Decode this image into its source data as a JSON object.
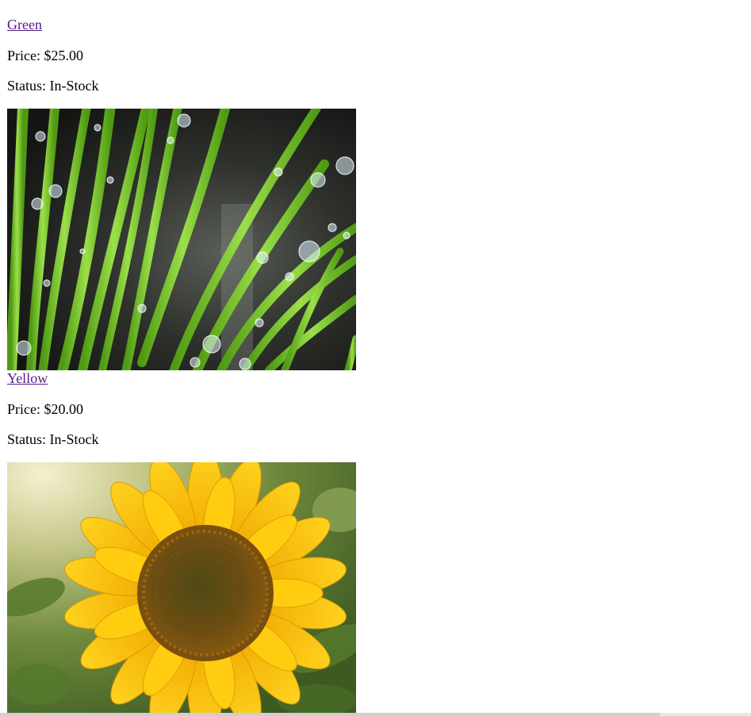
{
  "products": [
    {
      "name": "Green",
      "price_text": "Price: $25.00",
      "status_text": "Status: In-Stock",
      "image_icon": "green-stems-with-water-drops"
    },
    {
      "name": "Yellow",
      "price_text": "Price: $20.00",
      "status_text": "Status: In-Stock",
      "image_icon": "sunflower"
    }
  ],
  "colors": {
    "link": "#551a8b",
    "text": "#000000"
  }
}
